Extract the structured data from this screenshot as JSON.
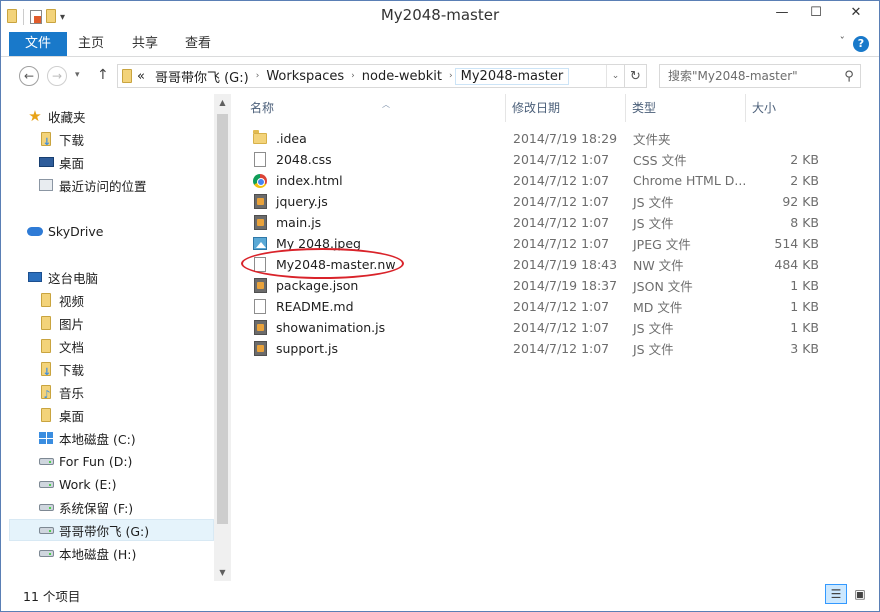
{
  "window": {
    "title": "My2048-master",
    "minimize_glyph": "—",
    "maximize_glyph": "☐",
    "close_glyph": "✕"
  },
  "qat": {
    "dropdown_glyph": "▾"
  },
  "ribbon": {
    "tabs": [
      "文件",
      "主页",
      "共享",
      "查看"
    ],
    "collapse_glyph": "ˇ",
    "help_glyph": "?"
  },
  "nav": {
    "back_glyph": "←",
    "forward_glyph": "→",
    "history_glyph": "▾",
    "up_glyph": "↑",
    "breadcrumb_overflow": "«",
    "breadcrumb": [
      "哥哥带你飞 (G:)",
      "Workspaces",
      "node-webkit",
      "My2048-master"
    ],
    "crumb_sep_glyph": "›",
    "dropdown_glyph": "⌄",
    "refresh_glyph": "↻",
    "search_placeholder": "搜索\"My2048-master\"",
    "search_glyph": "⚲"
  },
  "sidebar": {
    "up_glyph": "▲",
    "down_glyph": "▼",
    "items": [
      {
        "label": "收藏夹",
        "icon": "star-icon"
      },
      {
        "label": "下载",
        "icon": "downloads-folder-icon"
      },
      {
        "label": "桌面",
        "icon": "desktop-icon"
      },
      {
        "label": "最近访问的位置",
        "icon": "recent-places-icon"
      },
      {
        "label": "SkyDrive",
        "icon": "cloud-icon"
      },
      {
        "label": "这台电脑",
        "icon": "computer-icon"
      },
      {
        "label": "视频",
        "icon": "videos-folder-icon"
      },
      {
        "label": "图片",
        "icon": "pictures-folder-icon"
      },
      {
        "label": "文档",
        "icon": "documents-folder-icon"
      },
      {
        "label": "下载",
        "icon": "downloads-folder-icon"
      },
      {
        "label": "音乐",
        "icon": "music-folder-icon"
      },
      {
        "label": "桌面",
        "icon": "desktop-folder-icon"
      },
      {
        "label": "本地磁盘 (C:)",
        "icon": "system-drive-icon"
      },
      {
        "label": "For Fun (D:)",
        "icon": "drive-icon"
      },
      {
        "label": "Work (E:)",
        "icon": "drive-icon"
      },
      {
        "label": "系统保留 (F:)",
        "icon": "drive-icon"
      },
      {
        "label": "哥哥带你飞 (G:)",
        "icon": "drive-icon",
        "selected": true
      },
      {
        "label": "本地磁盘 (H:)",
        "icon": "drive-icon"
      }
    ]
  },
  "columns": {
    "sort_glyph": "︿",
    "name": "名称",
    "date": "修改日期",
    "type": "类型",
    "size": "大小"
  },
  "files": [
    {
      "name": ".idea",
      "date": "2014/7/19 18:29",
      "type": "文件夹",
      "size": "",
      "icon": "folder-icon"
    },
    {
      "name": "2048.css",
      "date": "2014/7/12 1:07",
      "type": "CSS 文件",
      "size": "2 KB",
      "icon": "document-icon"
    },
    {
      "name": "index.html",
      "date": "2014/7/12 1:07",
      "type": "Chrome HTML D...",
      "size": "2 KB",
      "icon": "chrome-icon"
    },
    {
      "name": "jquery.js",
      "date": "2014/7/12 1:07",
      "type": "JS 文件",
      "size": "92 KB",
      "icon": "script-icon"
    },
    {
      "name": "main.js",
      "date": "2014/7/12 1:07",
      "type": "JS 文件",
      "size": "8 KB",
      "icon": "script-icon"
    },
    {
      "name": "My 2048.jpeg",
      "date": "2014/7/12 1:07",
      "type": "JPEG 文件",
      "size": "514 KB",
      "icon": "image-icon"
    },
    {
      "name": "My2048-master.nw",
      "date": "2014/7/19 18:43",
      "type": "NW 文件",
      "size": "484 KB",
      "icon": "document-icon"
    },
    {
      "name": "package.json",
      "date": "2014/7/19 18:37",
      "type": "JSON 文件",
      "size": "1 KB",
      "icon": "script-icon"
    },
    {
      "name": "README.md",
      "date": "2014/7/12 1:07",
      "type": "MD 文件",
      "size": "1 KB",
      "icon": "document-icon"
    },
    {
      "name": "showanimation.js",
      "date": "2014/7/12 1:07",
      "type": "JS 文件",
      "size": "1 KB",
      "icon": "script-icon"
    },
    {
      "name": "support.js",
      "date": "2014/7/12 1:07",
      "type": "JS 文件",
      "size": "3 KB",
      "icon": "script-icon"
    }
  ],
  "status": {
    "item_count": "11 个项目",
    "details_glyph": "☰",
    "icons_glyph": "▣"
  },
  "colors": {
    "accent": "#1979ca",
    "highlight_circle": "#d9232a",
    "selected_bg": "#e5f3fb"
  }
}
